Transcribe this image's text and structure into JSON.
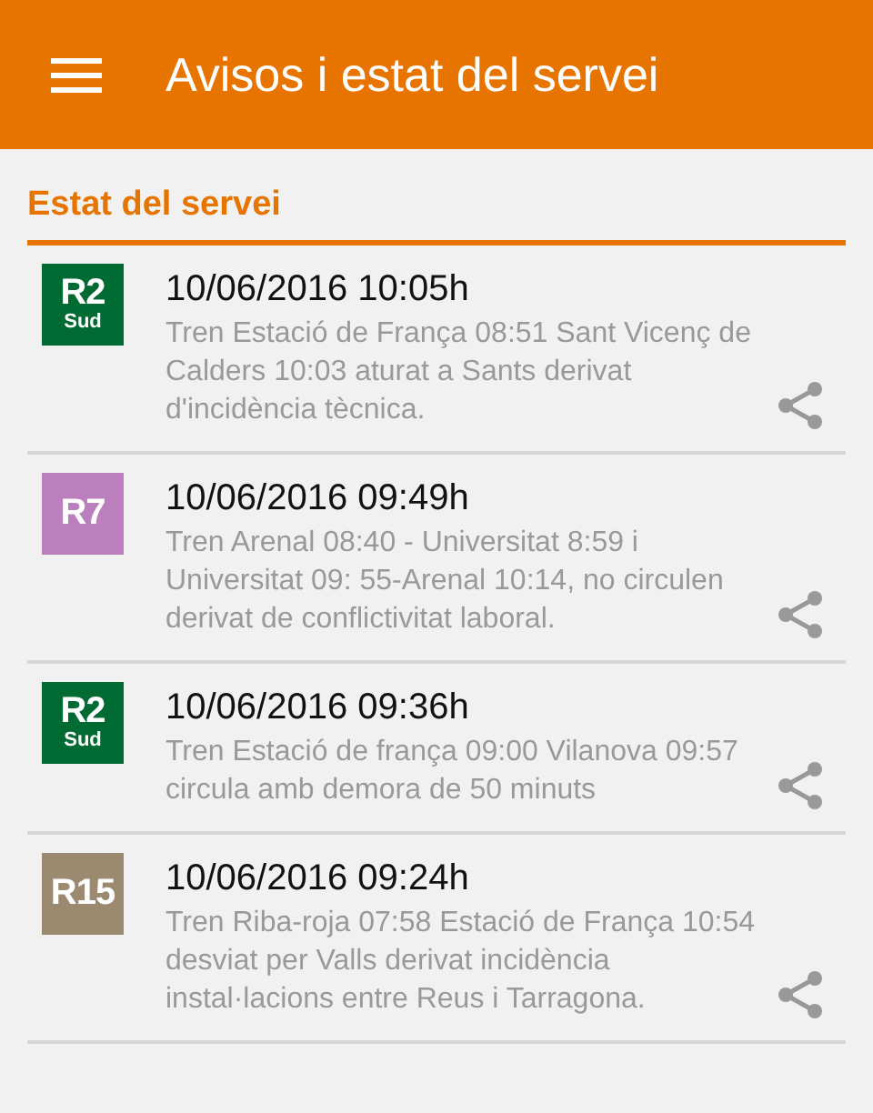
{
  "app_bar": {
    "title": "Avisos i estat del servei"
  },
  "section": {
    "title": "Estat del servei"
  },
  "notices": [
    {
      "line": "R2",
      "subline": "Sud",
      "color": "#006a33",
      "datetime": "10/06/2016 10:05h",
      "text": "Tren Estació de França 08:51 Sant Vicenç de Calders 10:03 aturat a Sants derivat d'incidència tècnica."
    },
    {
      "line": "R7",
      "color": "#bc7fbd",
      "datetime": "10/06/2016 09:49h",
      "text": "Tren Arenal 08:40 - Universitat 8:59 i Universitat 09: 55-Arenal 10:14, no circulen derivat de conflictivitat laboral."
    },
    {
      "line": "R2",
      "subline": "Sud",
      "color": "#006a33",
      "datetime": "10/06/2016 09:36h",
      "text": "Tren Estació de frança 09:00 Vilanova 09:57 circula amb demora de 50 minuts"
    },
    {
      "line": "R15",
      "color": "#9b8a70",
      "datetime": "10/06/2016 09:24h",
      "text": "Tren Riba-roja 07:58 Estació de França 10:54 desviat per Valls derivat incidència instal·lacions entre Reus i Tarragona."
    }
  ]
}
